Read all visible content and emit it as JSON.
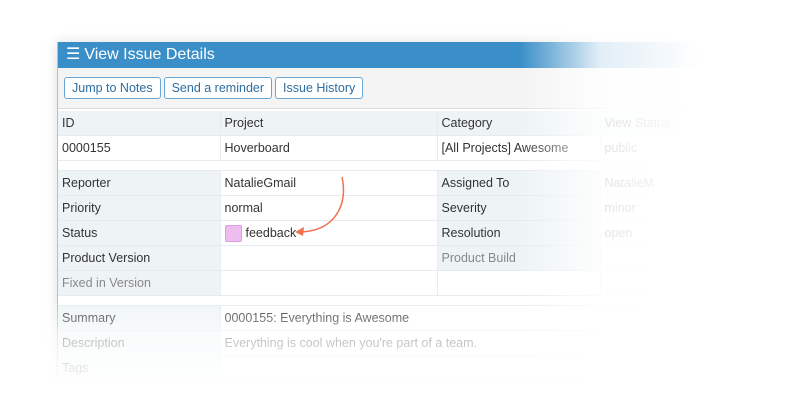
{
  "header": {
    "title": "View Issue Details",
    "icon": "menu-icon"
  },
  "toolbar": {
    "jump": "Jump to Notes",
    "remind": "Send a reminder",
    "history": "Issue History"
  },
  "table": {
    "h": [
      "ID",
      "Project",
      "Category",
      "View Status"
    ],
    "v": [
      "0000155",
      "Hoverboard",
      "[All Projects] Awesome",
      "public"
    ],
    "reporter_l": "Reporter",
    "reporter": "NatalieGmail",
    "assigned_l": "Assigned To",
    "assigned": "NatalieM",
    "priority_l": "Priority",
    "priority": "normal",
    "severity_l": "Severity",
    "severity": "minor",
    "status_l": "Status",
    "status": "feedback",
    "status_color": "#eebcee",
    "resolution_l": "Resolution",
    "resolution": "open",
    "pv_l": "Product Version",
    "pb_l": "Product Build",
    "fixed_l": "Fixed in Version",
    "summary_l": "Summary",
    "summary": "0000155: Everything is Awesome",
    "desc_l": "Description",
    "desc": "Everything is cool when you're part of a team.",
    "tags_l": "Tags"
  },
  "annotation": {
    "arrow_color": "#f07050"
  }
}
